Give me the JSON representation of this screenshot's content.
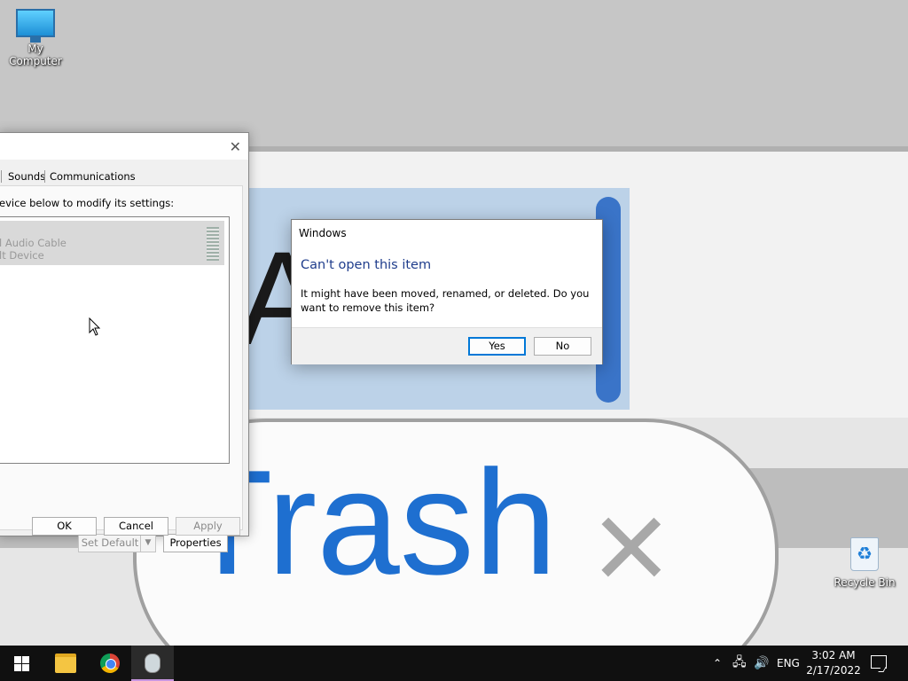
{
  "wallpaper": {
    "word": "Trash",
    "partial_word": "Ar",
    "close_glyph": "×"
  },
  "desktop": {
    "icons": [
      {
        "label": "My Computer",
        "icon": "monitor-icon"
      },
      {
        "label": "Recycle Bin",
        "icon": "recycle-bin-icon"
      }
    ]
  },
  "sound_dialog": {
    "close_glyph": "✕",
    "tabs": [
      {
        "label": "Sounds"
      },
      {
        "label": "Communications"
      }
    ],
    "instruction": "evice below to modify its settings:",
    "devices": [
      {
        "name": "l Audio Cable",
        "status": "lt Device",
        "state": "disabled"
      }
    ],
    "buttons": {
      "set_default": "Set Default",
      "properties": "Properties",
      "ok": "OK",
      "cancel": "Cancel",
      "apply": "Apply"
    }
  },
  "message_box": {
    "title": "Windows",
    "heading": "Can't open this item",
    "body": "It might have been moved, renamed, or deleted. Do you want to remove this item?",
    "buttons": {
      "yes": "Yes",
      "no": "No"
    },
    "default_button": "yes"
  },
  "taskbar": {
    "pinned": [
      {
        "name": "Start",
        "icon": "windows-logo-icon"
      },
      {
        "name": "File Explorer",
        "icon": "folder-icon"
      },
      {
        "name": "Google Chrome",
        "icon": "chrome-icon"
      },
      {
        "name": "Active app",
        "icon": "app-icon",
        "active": true
      }
    ],
    "tray": {
      "language": "ENG",
      "time": "3:02 AM",
      "date": "2/17/2022"
    }
  },
  "colors": {
    "accent": "#0078d7",
    "heading_blue": "#1f3d8c",
    "taskbar": "#101010",
    "wallpaper_blue": "#1e6fd0"
  }
}
